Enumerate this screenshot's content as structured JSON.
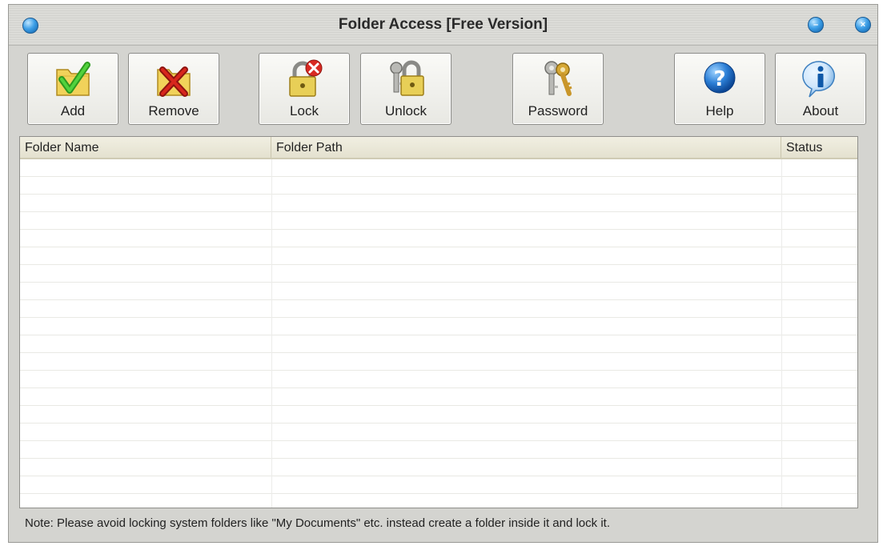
{
  "window": {
    "title": "Folder Access [Free Version]"
  },
  "toolbar": {
    "add_label": "Add",
    "remove_label": "Remove",
    "lock_label": "Lock",
    "unlock_label": "Unlock",
    "password_label": "Password",
    "help_label": "Help",
    "about_label": "About"
  },
  "list": {
    "columns": [
      "Folder Name",
      "Folder Path",
      "Status"
    ],
    "rows": []
  },
  "footer": {
    "note": "Note: Please avoid locking system folders like \"My Documents\" etc. instead create a folder inside it and lock it."
  },
  "colors": {
    "accent_blue": "#3ea0e8",
    "check_green": "#3cbb2a",
    "remove_red": "#c8201a",
    "folder_yellow": "#f1d25a"
  }
}
